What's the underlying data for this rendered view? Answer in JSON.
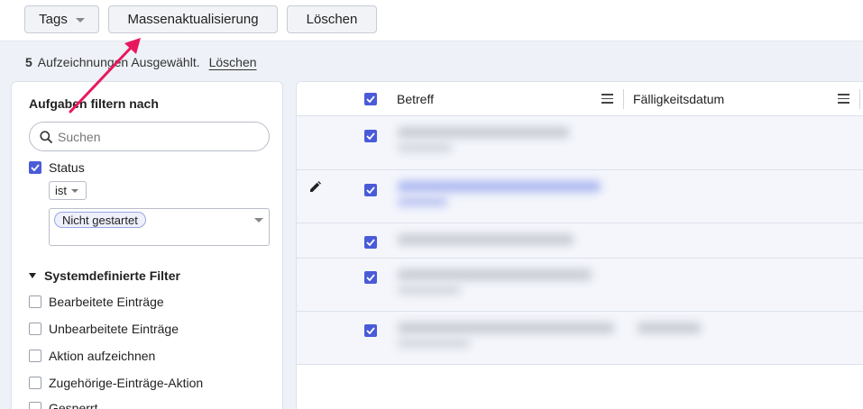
{
  "toolbar": {
    "tags_label": "Tags",
    "mass_update_label": "Massenaktualisierung",
    "delete_label": "Löschen"
  },
  "selection": {
    "count": "5",
    "text": "Aufzeichnungen Ausgewählt.",
    "clear_link": "Löschen"
  },
  "filter_panel": {
    "title": "Aufgaben filtern nach",
    "search_placeholder": "Suchen",
    "status_label": "Status",
    "status_checked": true,
    "operator": "ist",
    "status_values": [
      "Nicht gestartet"
    ],
    "section_title": "Systemdefinierte Filter",
    "filters": [
      "Bearbeitete Einträge",
      "Unbearbeitete Einträge",
      "Aktion aufzeichnen",
      "Zugehörige-Einträge-Aktion",
      "Gesperrt"
    ]
  },
  "grid": {
    "columns": [
      "Betreff",
      "Fälligkeitsdatum"
    ],
    "selected_rows": 5
  },
  "colors": {
    "accent": "#4a5bd8",
    "arrow": "#e8185e",
    "row_selected_bg": "#f4f6fc"
  }
}
